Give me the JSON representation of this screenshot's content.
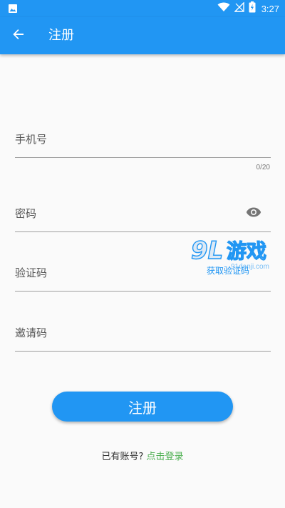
{
  "status_bar": {
    "time": "3:27",
    "icons": [
      "image-notification-icon",
      "wifi-icon",
      "no-signal-icon",
      "battery-charging-icon"
    ]
  },
  "app_bar": {
    "back_icon": "arrow-left-icon",
    "title": "注册"
  },
  "form": {
    "phone": {
      "placeholder": "手机号",
      "counter": "0/20"
    },
    "password": {
      "placeholder": "密码",
      "toggle_icon": "eye-icon"
    },
    "verification": {
      "placeholder": "验证码",
      "get_code_label": "获取验证码"
    },
    "invite": {
      "placeholder": "邀请码"
    }
  },
  "register_button": {
    "label": "注册"
  },
  "footer": {
    "prompt": "已有账号?",
    "login_link": "点击登录"
  },
  "watermark": {
    "logo_text": "9L游戏",
    "site": "91danji.com"
  },
  "colors": {
    "primary": "#2196f3",
    "link_green": "#4caf50",
    "background": "#fafafa",
    "divider": "#9e9e9e"
  }
}
